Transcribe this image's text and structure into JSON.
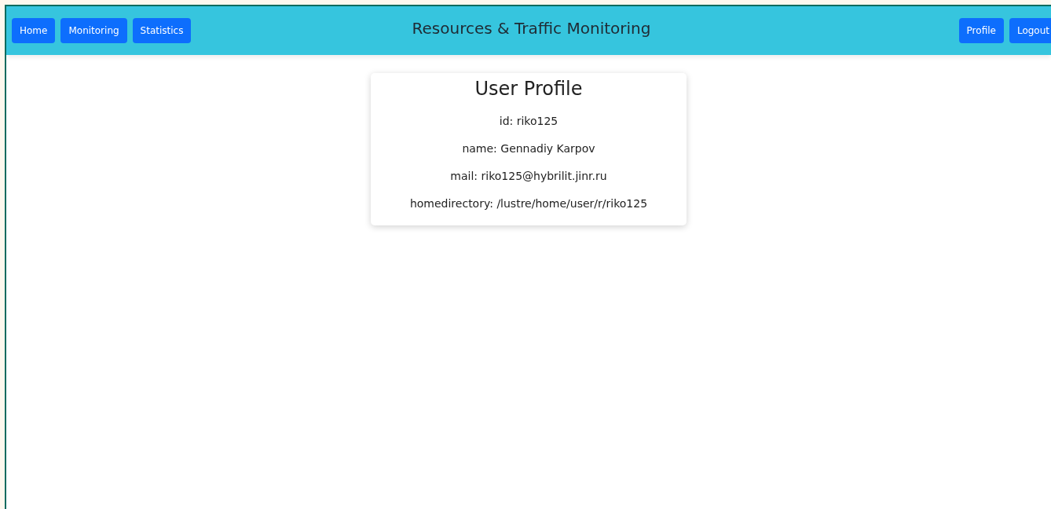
{
  "navbar": {
    "left_buttons": [
      "Home",
      "Monitoring",
      "Statistics"
    ],
    "title": "Resources & Traffic Monitoring",
    "right_buttons": [
      "Profile",
      "Logout"
    ]
  },
  "profile_card": {
    "title": "User Profile",
    "fields": [
      "id: riko125",
      "name: Gennadiy Karpov",
      "mail: riko125@hybrilit.jinr.ru",
      "homedirectory: /lustre/home/user/r/riko125"
    ]
  }
}
